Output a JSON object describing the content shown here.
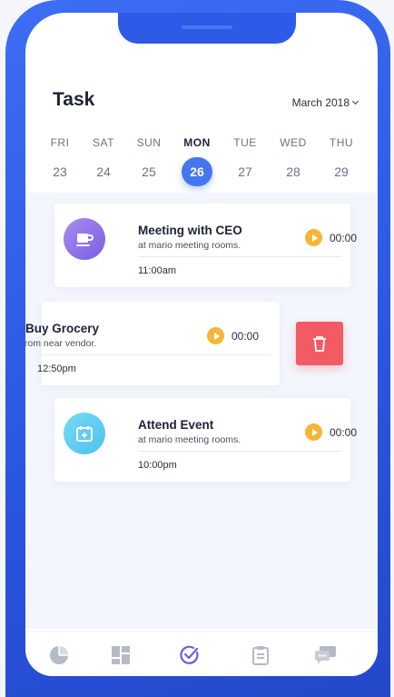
{
  "header": {
    "title": "Task",
    "month_label": "March 2018"
  },
  "calendar": {
    "days": [
      {
        "name": "FRI",
        "date": "23"
      },
      {
        "name": "SAT",
        "date": "24"
      },
      {
        "name": "SUN",
        "date": "25"
      },
      {
        "name": "MON",
        "date": "26",
        "selected": true
      },
      {
        "name": "TUE",
        "date": "27"
      },
      {
        "name": "WED",
        "date": "28"
      },
      {
        "name": "THU",
        "date": "29"
      }
    ]
  },
  "tasks": [
    {
      "title": "Meeting with CEO",
      "subtitle": "at mario meeting rooms.",
      "time": "11:00am",
      "duration": "00:00",
      "icon": "coffee-cup-icon"
    },
    {
      "title": "Buy Grocery",
      "subtitle": "from near vendor.",
      "time": "12:50pm",
      "duration": "00:00",
      "icon": "delete-trash-icon"
    },
    {
      "title": "Attend Event",
      "subtitle": "at mario meeting rooms.",
      "time": "10:00pm",
      "duration": "00:00",
      "icon": "calendar-add-icon"
    }
  ],
  "nav": {
    "items": [
      "pie-chart-icon",
      "dashboard-grid-icon",
      "check-circle-icon",
      "clipboard-icon",
      "chat-bubble-icon"
    ],
    "active_index": 2
  },
  "colors": {
    "accent": "#4477ee",
    "phone_frame": "#3d6ef5",
    "play": "#f7b537",
    "delete": "#f25a64",
    "nav_active": "#6b5ce7"
  }
}
